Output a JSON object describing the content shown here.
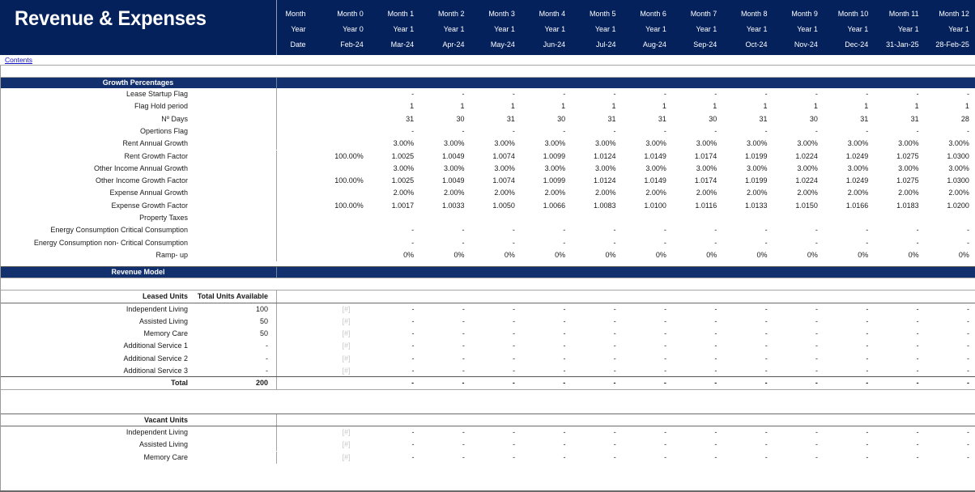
{
  "title": "Revenue & Expenses",
  "contents_link": "Contents",
  "colors": {
    "navy": "#04215c",
    "section_bar": "#12306e",
    "link": "#1414c8",
    "placeholder": "#c9c9c9"
  },
  "header": {
    "row_labels": [
      "Month",
      "Year",
      "Date"
    ],
    "months": [
      "Month 0",
      "Month 1",
      "Month 2",
      "Month 3",
      "Month 4",
      "Month 5",
      "Month 6",
      "Month 7",
      "Month 8",
      "Month 9",
      "Month 10",
      "Month 11",
      "Month 12"
    ],
    "years": [
      "Year 0",
      "Year 1",
      "Year 1",
      "Year 1",
      "Year 1",
      "Year 1",
      "Year 1",
      "Year 1",
      "Year 1",
      "Year 1",
      "Year 1",
      "Year 1",
      "Year 1"
    ],
    "dates": [
      "Feb-24",
      "Mar-24",
      "Apr-24",
      "May-24",
      "Jun-24",
      "Jul-24",
      "Aug-24",
      "Sep-24",
      "Oct-24",
      "Nov-24",
      "Dec-24",
      "31-Jan-25",
      "28-Feb-25"
    ]
  },
  "sections": {
    "growth": {
      "bar_label": "Growth Percentages",
      "rows": [
        {
          "label": "Lease Startup Flag",
          "m0": "",
          "values": [
            "-",
            "-",
            "-",
            "-",
            "-",
            "-",
            "-",
            "-",
            "-",
            "-",
            "-",
            "-"
          ]
        },
        {
          "label": "Flag Hold period",
          "m0": "",
          "values": [
            "1",
            "1",
            "1",
            "1",
            "1",
            "1",
            "1",
            "1",
            "1",
            "1",
            "1",
            "1"
          ]
        },
        {
          "label": "Nº Days",
          "m0": "",
          "values": [
            "31",
            "30",
            "31",
            "30",
            "31",
            "31",
            "30",
            "31",
            "30",
            "31",
            "31",
            "28"
          ]
        },
        {
          "label": "Opertions Flag",
          "m0": "",
          "values": [
            "-",
            "-",
            "-",
            "-",
            "-",
            "-",
            "-",
            "-",
            "-",
            "-",
            "-",
            "-"
          ]
        },
        {
          "label": "Rent Annual Growth",
          "m0": "",
          "values": [
            "3.00%",
            "3.00%",
            "3.00%",
            "3.00%",
            "3.00%",
            "3.00%",
            "3.00%",
            "3.00%",
            "3.00%",
            "3.00%",
            "3.00%",
            "3.00%"
          ]
        },
        {
          "label": "Rent Growth Factor",
          "m0": "100.00%",
          "values": [
            "1.0025",
            "1.0049",
            "1.0074",
            "1.0099",
            "1.0124",
            "1.0149",
            "1.0174",
            "1.0199",
            "1.0224",
            "1.0249",
            "1.0275",
            "1.0300"
          ]
        },
        {
          "label": "Other Income Annual Growth",
          "m0": "",
          "values": [
            "3.00%",
            "3.00%",
            "3.00%",
            "3.00%",
            "3.00%",
            "3.00%",
            "3.00%",
            "3.00%",
            "3.00%",
            "3.00%",
            "3.00%",
            "3.00%"
          ]
        },
        {
          "label": "Other Income Growth Factor",
          "m0": "100.00%",
          "values": [
            "1.0025",
            "1.0049",
            "1.0074",
            "1.0099",
            "1.0124",
            "1.0149",
            "1.0174",
            "1.0199",
            "1.0224",
            "1.0249",
            "1.0275",
            "1.0300"
          ]
        },
        {
          "label": "Expense Annual Growth",
          "m0": "",
          "values": [
            "2.00%",
            "2.00%",
            "2.00%",
            "2.00%",
            "2.00%",
            "2.00%",
            "2.00%",
            "2.00%",
            "2.00%",
            "2.00%",
            "2.00%",
            "2.00%"
          ]
        },
        {
          "label": "Expense Growth Factor",
          "m0": "100.00%",
          "values": [
            "1.0017",
            "1.0033",
            "1.0050",
            "1.0066",
            "1.0083",
            "1.0100",
            "1.0116",
            "1.0133",
            "1.0150",
            "1.0166",
            "1.0183",
            "1.0200"
          ]
        },
        {
          "label": "Property Taxes",
          "m0": "",
          "values": [
            "",
            "",
            "",
            "",
            "",
            "",
            "",
            "",
            "",
            "",
            "",
            ""
          ]
        },
        {
          "label": "Energy Consumption Critical Consumption",
          "m0": "",
          "values": [
            "-",
            "-",
            "-",
            "-",
            "-",
            "-",
            "-",
            "-",
            "-",
            "-",
            "-",
            "-"
          ]
        },
        {
          "label": "Energy Consumption non- Critical Consumption",
          "m0": "",
          "values": [
            "-",
            "-",
            "-",
            "-",
            "-",
            "-",
            "-",
            "-",
            "-",
            "-",
            "-",
            "-"
          ]
        },
        {
          "label": "Ramp- up",
          "m0": "",
          "values": [
            "0%",
            "0%",
            "0%",
            "0%",
            "0%",
            "0%",
            "0%",
            "0%",
            "0%",
            "0%",
            "0%",
            "0%"
          ]
        }
      ]
    },
    "revenue_model": {
      "bar_label": "Revenue Model",
      "leased_units": {
        "header_label": "Leased Units",
        "header_units": "Total Units Available",
        "rows": [
          {
            "label": "Independent Living",
            "units": "100",
            "m0": "[#]",
            "values": [
              "-",
              "-",
              "-",
              "-",
              "-",
              "-",
              "-",
              "-",
              "-",
              "-",
              "-",
              "-"
            ]
          },
          {
            "label": "Assisted Living",
            "units": "50",
            "m0": "[#]",
            "values": [
              "-",
              "-",
              "-",
              "-",
              "-",
              "-",
              "-",
              "-",
              "-",
              "-",
              "-",
              "-"
            ]
          },
          {
            "label": "Memory Care",
            "units": "50",
            "m0": "[#]",
            "values": [
              "-",
              "-",
              "-",
              "-",
              "-",
              "-",
              "-",
              "-",
              "-",
              "-",
              "-",
              "-"
            ]
          },
          {
            "label": "Additional Service 1",
            "units": "-",
            "m0": "[#]",
            "values": [
              "-",
              "-",
              "-",
              "-",
              "-",
              "-",
              "-",
              "-",
              "-",
              "-",
              "-",
              "-"
            ]
          },
          {
            "label": "Additional Service 2",
            "units": "-",
            "m0": "[#]",
            "values": [
              "-",
              "-",
              "-",
              "-",
              "-",
              "-",
              "-",
              "-",
              "-",
              "-",
              "-",
              "-"
            ]
          },
          {
            "label": "Additional Service 3",
            "units": "-",
            "m0": "[#]",
            "values": [
              "-",
              "-",
              "-",
              "-",
              "-",
              "-",
              "-",
              "-",
              "-",
              "-",
              "-",
              "-"
            ]
          }
        ],
        "total": {
          "label": "Total",
          "units": "200",
          "m0": "",
          "values": [
            "-",
            "-",
            "-",
            "-",
            "-",
            "-",
            "-",
            "-",
            "-",
            "-",
            "-",
            "-"
          ]
        }
      },
      "vacant_units": {
        "header_label": "Vacant Units",
        "rows": [
          {
            "label": "Independent Living",
            "units": "",
            "m0": "[#]",
            "values": [
              "-",
              "-",
              "-",
              "-",
              "-",
              "-",
              "-",
              "-",
              "-",
              "-",
              "-",
              "-"
            ]
          },
          {
            "label": "Assisted Living",
            "units": "",
            "m0": "[#]",
            "values": [
              "-",
              "-",
              "-",
              "-",
              "-",
              "-",
              "-",
              "-",
              "-",
              "-",
              "-",
              "-"
            ]
          },
          {
            "label": "Memory Care",
            "units": "",
            "m0": "[#]",
            "values": [
              "-",
              "-",
              "-",
              "-",
              "-",
              "-",
              "-",
              "-",
              "-",
              "-",
              "-",
              "-"
            ]
          }
        ]
      }
    }
  }
}
